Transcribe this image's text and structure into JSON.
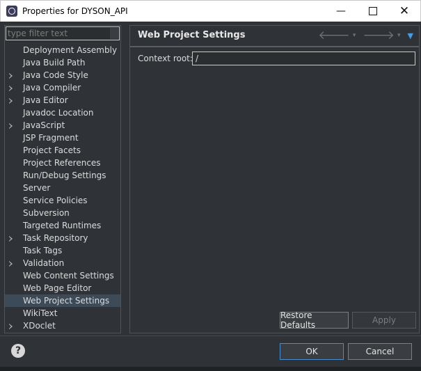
{
  "window": {
    "title": "Properties for DYSON_API",
    "minimize": "—",
    "close": "✕"
  },
  "filter": {
    "placeholder": "type filter text"
  },
  "tree": [
    {
      "label": "Deployment Assembly",
      "expandable": false
    },
    {
      "label": "Java Build Path",
      "expandable": false
    },
    {
      "label": "Java Code Style",
      "expandable": true
    },
    {
      "label": "Java Compiler",
      "expandable": true
    },
    {
      "label": "Java Editor",
      "expandable": true
    },
    {
      "label": "Javadoc Location",
      "expandable": false
    },
    {
      "label": "JavaScript",
      "expandable": true
    },
    {
      "label": "JSP Fragment",
      "expandable": false
    },
    {
      "label": "Project Facets",
      "expandable": false
    },
    {
      "label": "Project References",
      "expandable": false
    },
    {
      "label": "Run/Debug Settings",
      "expandable": false
    },
    {
      "label": "Server",
      "expandable": false
    },
    {
      "label": "Service Policies",
      "expandable": false
    },
    {
      "label": "Subversion",
      "expandable": false
    },
    {
      "label": "Targeted Runtimes",
      "expandable": false
    },
    {
      "label": "Task Repository",
      "expandable": true
    },
    {
      "label": "Task Tags",
      "expandable": false
    },
    {
      "label": "Validation",
      "expandable": true
    },
    {
      "label": "Web Content Settings",
      "expandable": false
    },
    {
      "label": "Web Page Editor",
      "expandable": false
    },
    {
      "label": "Web Project Settings",
      "expandable": false,
      "selected": true
    },
    {
      "label": "WikiText",
      "expandable": false
    },
    {
      "label": "XDoclet",
      "expandable": true
    }
  ],
  "page": {
    "title": "Web Project Settings",
    "context_root_label": "Context root:",
    "context_root_value": "/"
  },
  "nav": {
    "back": "🡐",
    "forward": "🡒",
    "dropdown": "▾",
    "menu": "▼"
  },
  "buttons": {
    "restore_defaults": "Restore Defaults",
    "apply": "Apply",
    "ok": "OK",
    "cancel": "Cancel",
    "help": "?"
  },
  "colors": {
    "background": "#2f3337",
    "selection": "#3d4a58",
    "accent": "#4a9be0"
  }
}
